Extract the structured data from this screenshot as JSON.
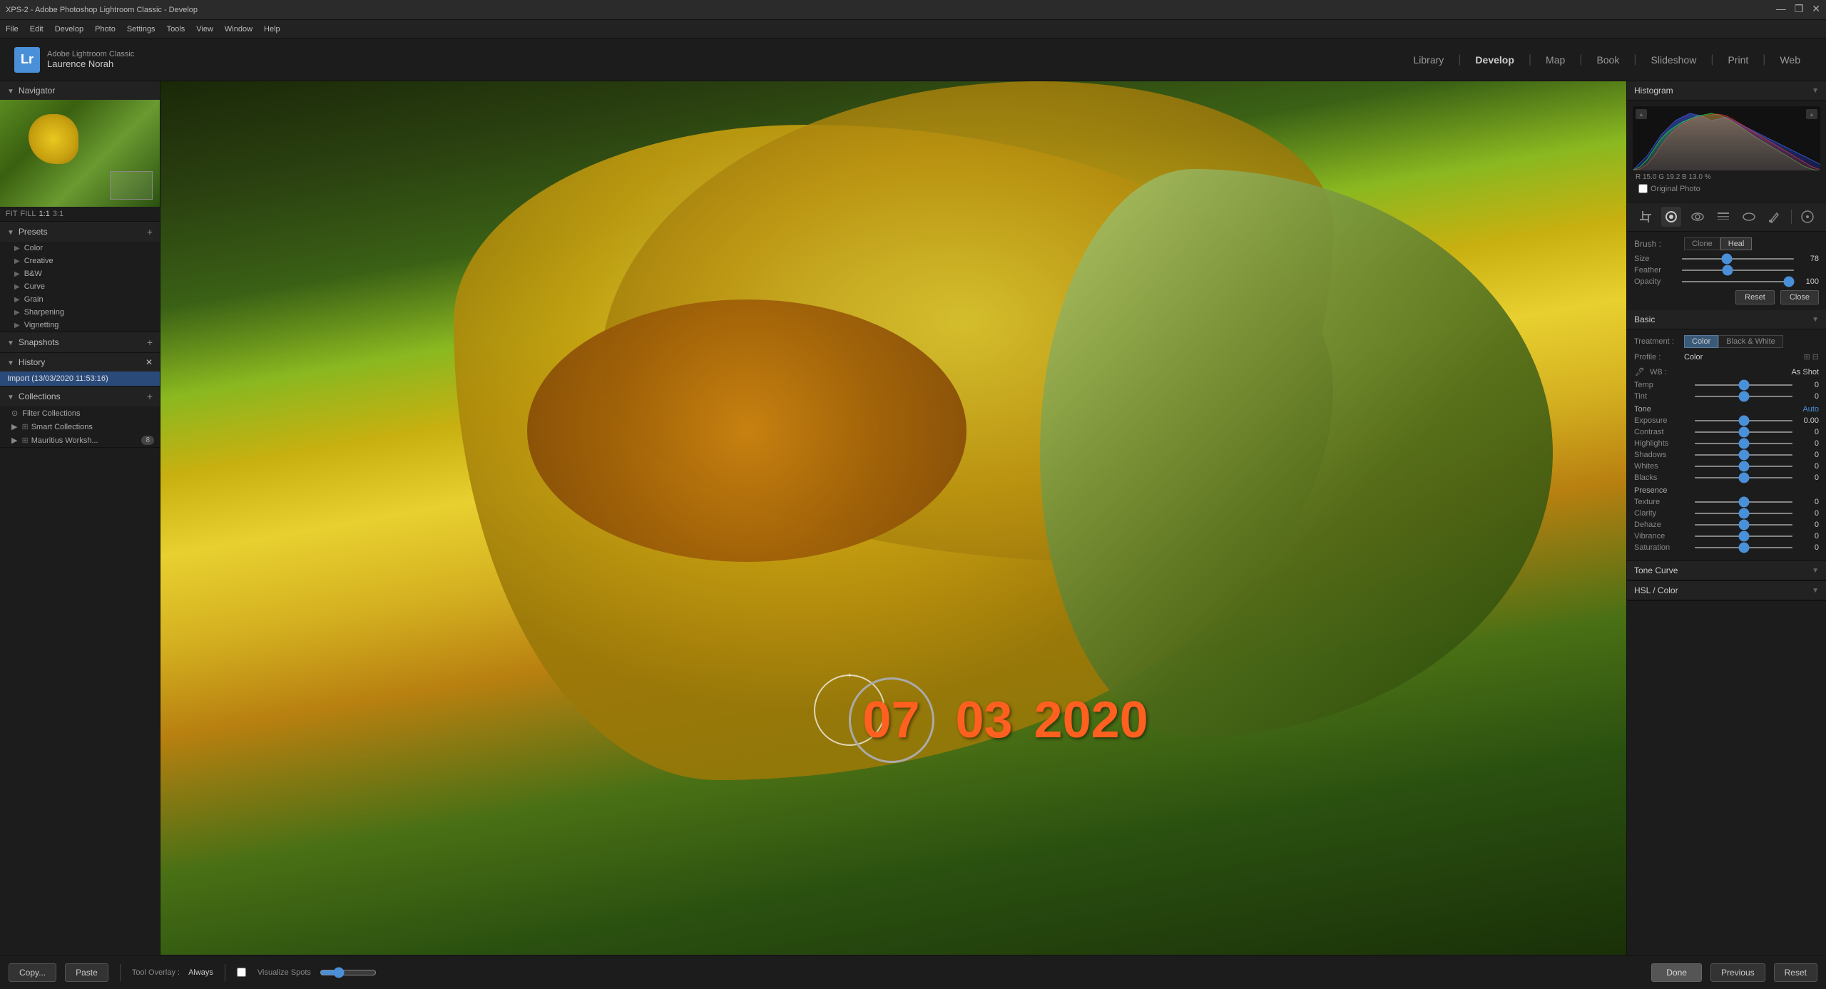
{
  "window": {
    "title": "XPS-2 - Adobe Photoshop Lightroom Classic - Develop"
  },
  "titlebar": {
    "title": "XPS-2 - Adobe Photoshop Lightroom Classic - Develop",
    "min": "—",
    "restore": "❐",
    "close": "✕"
  },
  "menubar": {
    "items": [
      "File",
      "Edit",
      "Develop",
      "Photo",
      "Settings",
      "Tools",
      "View",
      "Window",
      "Help"
    ]
  },
  "topnav": {
    "logo": "Lr",
    "app_name": "Adobe Lightroom Classic",
    "user_name": "Laurence Norah",
    "modules": [
      "Library",
      "Develop",
      "Map",
      "Book",
      "Slideshow",
      "Print",
      "Web"
    ],
    "active_module": "Develop"
  },
  "left_panel": {
    "navigator": {
      "header": "Navigator",
      "fit_options": [
        "FIT",
        "FILL",
        "1:1",
        "3:1"
      ],
      "active_fit": "1:1"
    },
    "presets": {
      "header": "Presets",
      "add": "+",
      "items": [
        {
          "label": "Color",
          "arrow": "▶"
        },
        {
          "label": "Creative",
          "arrow": "▶"
        },
        {
          "label": "B&W",
          "arrow": "▶"
        },
        {
          "label": "Curve",
          "arrow": "▶"
        },
        {
          "label": "Grain",
          "arrow": "▶"
        },
        {
          "label": "Sharpening",
          "arrow": "▶"
        },
        {
          "label": "Vignetting",
          "arrow": "▶"
        }
      ]
    },
    "snapshots": {
      "header": "Snapshots",
      "add": "+",
      "items": []
    },
    "history": {
      "header": "History",
      "close": "✕",
      "items": [
        {
          "label": "Import (13/03/2020 11:53:16)",
          "active": true
        }
      ]
    },
    "collections": {
      "header": "Collections",
      "add": "+",
      "items": [
        {
          "label": "Filter Collections",
          "type": "filter",
          "icon": "⊙"
        },
        {
          "label": "Smart Collections",
          "arrow": "▶",
          "type": "smart"
        },
        {
          "label": "Mauritius Worksh...",
          "arrow": "▶",
          "type": "smart",
          "count": "8"
        }
      ]
    }
  },
  "image": {
    "date_parts": {
      "day": "07",
      "month": "03",
      "year": "2020"
    }
  },
  "bottom_toolbar": {
    "copy_btn": "Copy...",
    "paste_btn": "Paste",
    "tool_overlay_label": "Tool Overlay :",
    "tool_overlay_value": "Always",
    "visualize_spots_label": "Visualize Spots",
    "done_btn": "Done",
    "previous_btn": "Previous",
    "reset_btn": "Reset"
  },
  "right_panel": {
    "histogram": {
      "header": "Histogram",
      "values": "R  15.0  G  19.2  B  13.0 %",
      "original_photo": "Original Photo"
    },
    "tools": {
      "icons": [
        "crop",
        "spot-heal",
        "red-eye",
        "graduated",
        "radial",
        "adjustment-brush"
      ]
    },
    "spot_heal": {
      "brush_label": "Brush :",
      "clone_btn": "Clone",
      "heal_btn": "Heal",
      "size_label": "Size",
      "size_val": "78",
      "feather_label": "Feather",
      "feather_val": "",
      "opacity_label": "Opacity",
      "opacity_val": "100",
      "reset_btn": "Reset",
      "close_btn": "Close"
    },
    "basic": {
      "header": "Basic",
      "treatment_label": "Treatment :",
      "color_btn": "Color",
      "bw_btn": "Black & White",
      "profile_label": "Profile :",
      "profile_value": "Color",
      "wb_label": "WB :",
      "wb_value": "As Shot",
      "temp_label": "Temp",
      "temp_val": "0",
      "tint_label": "Tint",
      "tint_val": "0",
      "tone_label": "Tone",
      "auto_label": "Auto",
      "exposure_label": "Exposure",
      "exposure_val": "0.00",
      "contrast_label": "Contrast",
      "contrast_val": "0",
      "highlights_label": "Highlights",
      "highlights_val": "0",
      "shadows_label": "Shadows",
      "shadows_val": "0",
      "whites_label": "Whites",
      "whites_val": "0",
      "blacks_label": "Blacks",
      "blacks_val": "0",
      "presence_label": "Presence",
      "texture_label": "Texture",
      "texture_val": "0",
      "clarity_label": "Clarity",
      "clarity_val": "0",
      "dehaze_label": "Dehaze",
      "dehaze_val": "0",
      "vibrance_label": "Vibrance",
      "vibrance_val": "0",
      "saturation_label": "Saturation",
      "saturation_val": "0"
    },
    "tone_curve": {
      "header": "Tone Curve"
    },
    "hsl_color": {
      "header": "HSL / Color"
    }
  },
  "colors": {
    "accent": "#4a90d9",
    "active_bg": "#2a4a7a",
    "orange": "#ff6020",
    "panel_bg": "#1c1c1c",
    "panel_header_bg": "#222",
    "border": "#111",
    "text_primary": "#ccc",
    "text_secondary": "#888"
  }
}
